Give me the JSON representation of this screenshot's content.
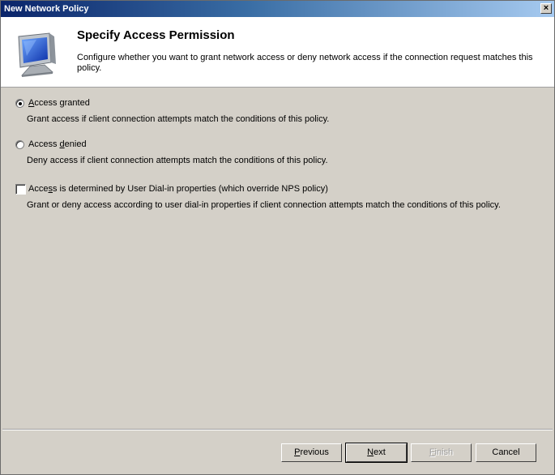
{
  "window": {
    "title": "New Network Policy",
    "close_label": "×"
  },
  "header": {
    "title": "Specify Access Permission",
    "description": "Configure whether you want to grant network access or deny network access if the connection request matches this policy.",
    "icon": "monitor-icon"
  },
  "options": [
    {
      "type": "radio",
      "label_pre": "",
      "label_key": "A",
      "label_post": "ccess granted",
      "checked": true,
      "description": "Grant access if client connection attempts match the conditions of this policy."
    },
    {
      "type": "radio",
      "label_pre": "Access ",
      "label_key": "d",
      "label_post": "enied",
      "checked": false,
      "description": "Deny access if client connection attempts match the conditions of this policy."
    },
    {
      "type": "checkbox",
      "label_pre": "Acce",
      "label_key": "s",
      "label_post": "s is determined by User Dial-in properties (which override NPS policy)",
      "checked": false,
      "description": "Grant or deny access according to user dial-in properties if client connection attempts match the conditions of this policy."
    }
  ],
  "buttons": {
    "previous": {
      "key": "P",
      "rest": "revious",
      "enabled": true
    },
    "next": {
      "key": "N",
      "rest": "ext",
      "enabled": true
    },
    "finish": {
      "key": "F",
      "rest": "inish",
      "enabled": false
    },
    "cancel": {
      "label": "Cancel",
      "enabled": true
    }
  }
}
